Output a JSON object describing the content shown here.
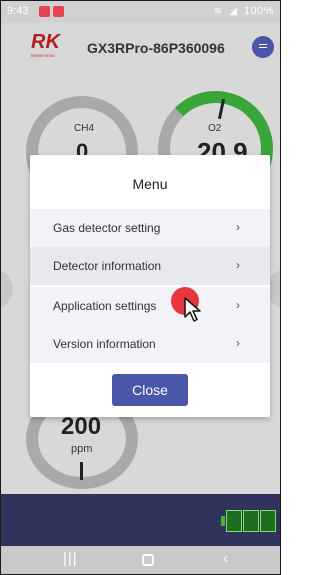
{
  "status_bar": {
    "time": "9:43",
    "battery_text": "100%",
    "icons": [
      "notification-icon",
      "notification-icon",
      "mute-icon",
      "location-icon",
      "wifi-icon",
      "signal-icon",
      "battery-icon"
    ]
  },
  "header": {
    "logo_text": "RK",
    "logo_subtext": "RIKEN KEIKI",
    "device_name": "GX3RPro-86P360096",
    "menu_icon": "menu-icon"
  },
  "gauges": {
    "ch4": {
      "label": "CH4",
      "value_partial": "0"
    },
    "o2": {
      "label": "O2",
      "value_partial": "20.9"
    },
    "bottom": {
      "value": "200",
      "unit": "ppm"
    }
  },
  "dialog": {
    "title": "Menu",
    "items": [
      {
        "label": "Gas detector setting",
        "chevron": "›"
      },
      {
        "label": "Detector information",
        "chevron": "›"
      },
      {
        "label": "Application settings",
        "chevron": "›"
      },
      {
        "label": "Version information",
        "chevron": "›"
      }
    ],
    "close_label": "Close"
  },
  "nav_bar": {
    "recent": "|||",
    "back": "‹"
  },
  "colors": {
    "accent": "#4a56a8",
    "logo_red": "#b41e1e",
    "gauge_green": "#3aa63a",
    "touch_red": "#e8363e",
    "battery_green": "#4ab23a"
  }
}
